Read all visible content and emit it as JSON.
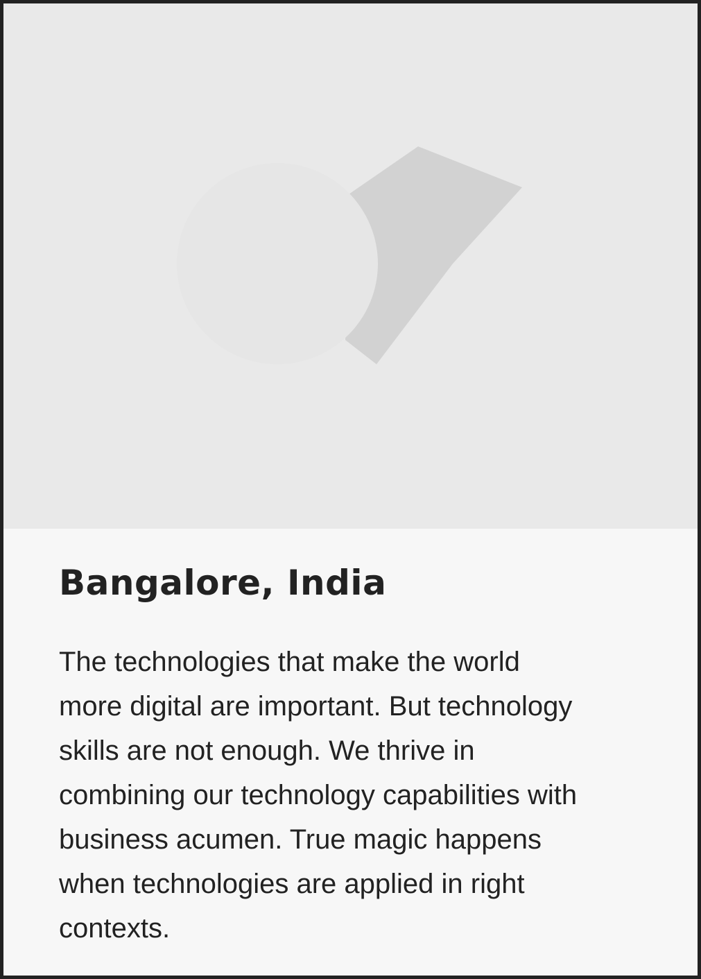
{
  "card": {
    "title": "Bangalore, India",
    "description": "The technologies that make the world\nmore digital are important. But technology\nskills are not enough. We thrive in\ncombining our technology capabilities with\nbusiness acumen. True magic happens\nwhen technologies are applied in right\ncontexts."
  },
  "media": {
    "icon": "image-placeholder-icon"
  },
  "colors": {
    "border": "#222222",
    "media_background": "#e9e9e9",
    "content_background": "#f7f7f7",
    "text": "#222222",
    "placeholder_circle": "#e6e6e6",
    "placeholder_shape": "#d2d2d2"
  }
}
